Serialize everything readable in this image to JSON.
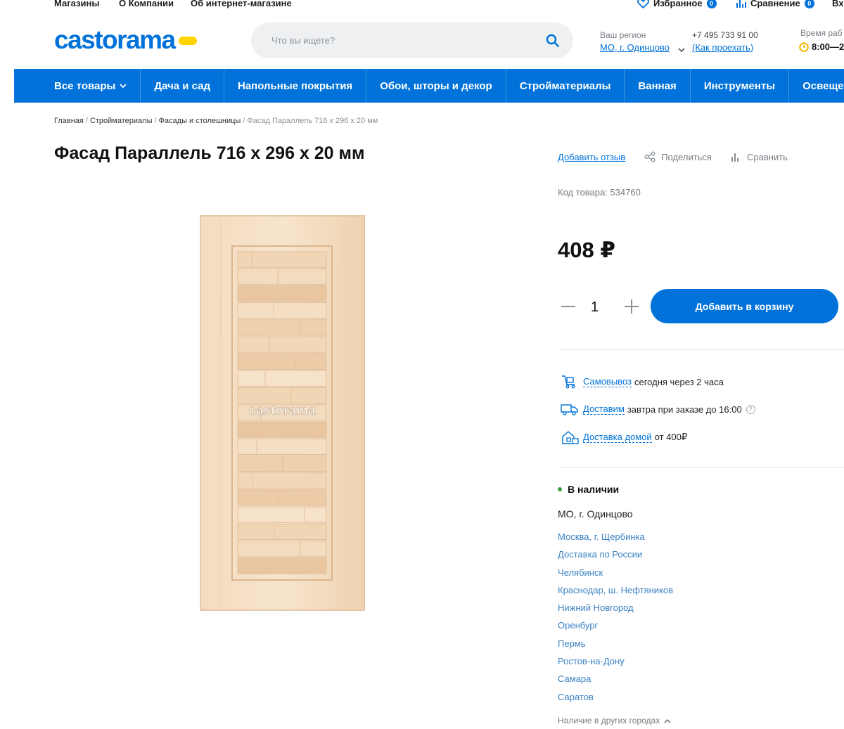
{
  "topbar": {
    "links": [
      "Магазины",
      "О Компании",
      "Об интернет-магазине"
    ],
    "favorites": {
      "label": "Избранное",
      "count": "0"
    },
    "compare": {
      "label": "Сравнение",
      "count": "0"
    },
    "login_label": "Вх"
  },
  "header": {
    "logo_text": "castorama",
    "search_placeholder": "Что вы ищете?",
    "region_caption": "Ваш регион",
    "region_value": "МО, г. Одинцово",
    "phone": "+7 495 733 91 00",
    "directions": "(Как проехать)",
    "hours_caption": "Время раб",
    "hours_value": "8:00—2"
  },
  "nav": {
    "items": [
      "Все товары",
      "Дача и сад",
      "Напольные покрытия",
      "Обои, шторы и декор",
      "Стройматериалы",
      "Ванная",
      "Инструменты",
      "Освещен"
    ]
  },
  "breadcrumb": [
    "Главная",
    "Стройматериалы",
    "Фасады и столешницы",
    "Фасад Параллель 716 x 296 x 20 мм"
  ],
  "product": {
    "title": "Фасад Параллель 716 x 296 x 20 мм",
    "review_link": "Добавить отзыв",
    "share_label": "Поделиться",
    "compare_label": "Сравнить",
    "code": "Код товара: 534760",
    "price": "408 ₽",
    "quantity": "1",
    "add_to_cart": "Добавить в корзину",
    "watermark": "castorama"
  },
  "delivery": [
    {
      "link": "Самовывоз",
      "text": "сегодня через 2 часа",
      "icon": "pickup-icon"
    },
    {
      "link": "Доставим",
      "text": "завтра при заказе до 16:00",
      "icon": "truck-icon"
    },
    {
      "link": "Доставка домой",
      "text": "от 400₽",
      "icon": "home-delivery-icon"
    }
  ],
  "availability": {
    "status": "В наличии",
    "region": "МО, г. Одинцово",
    "cities": [
      "Москва, г. Щербинка",
      "Доставка по России",
      "Челябинск",
      "Краснодар, ш. Нефтяников",
      "Нижний Новгород",
      "Оренбург",
      "Пермь",
      "Ростов-на-Дону",
      "Самара",
      "Саратов"
    ],
    "other_cities": "Наличие в других городах"
  },
  "colors": {
    "brand_blue": "#0072d9",
    "brand_yellow": "#ffd400",
    "in_stock_green": "#3aa13c"
  }
}
